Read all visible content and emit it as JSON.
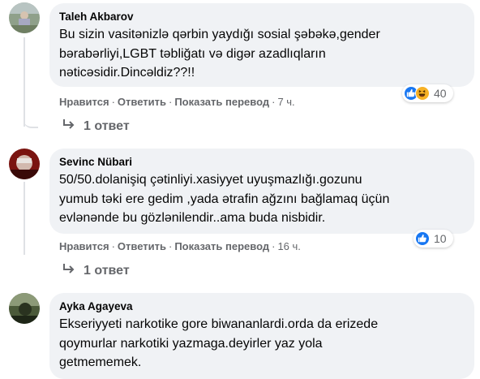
{
  "comments": [
    {
      "author": "Taleh Akbarov",
      "lines": [
        "Bu sizin vasitənizlə qərbin yaydığı sosial şəbəkə,gender",
        "bərabərliyi,LGBT təbliğatı və digər azadlıqların",
        "nəticəsidir.Dincəldiz??!!"
      ],
      "like_label": "Нравится",
      "reply_label": "Ответить",
      "translate_label": "Показать перевод",
      "time": "7 ч.",
      "reactions_count": "40",
      "reactions": [
        "like-icon",
        "haha-icon"
      ],
      "replies_label": "1 ответ"
    },
    {
      "author": "Sevinc Nübari",
      "lines": [
        "50/50.dolanişiq çətinliyi.xasiyyet uyuşmazlığı.gozunu",
        "yumub təki ere gedim ,yada ətrafin ağzını bağlamaq üçün",
        "evlənənde bu gözlənilendir..ama buda nisbidir."
      ],
      "like_label": "Нравится",
      "reply_label": "Ответить",
      "translate_label": "Показать перевод",
      "time": "16 ч.",
      "reactions_count": "10",
      "reactions": [
        "like-icon"
      ],
      "replies_label": "1 ответ"
    },
    {
      "author": "Ayka Agayeva",
      "lines": [
        "Ekseriyyeti narkotike gore biwananlardi.orda da erizede",
        "qoymurlar narkotiki yazmaga.deyirler yaz yola",
        "getmememek."
      ]
    }
  ],
  "colors": {
    "bubble": "#f0f2f5",
    "meta": "#65676b",
    "text": "#050505",
    "like_blue": "#1877f2",
    "haha_yellow": "#f7b125"
  }
}
